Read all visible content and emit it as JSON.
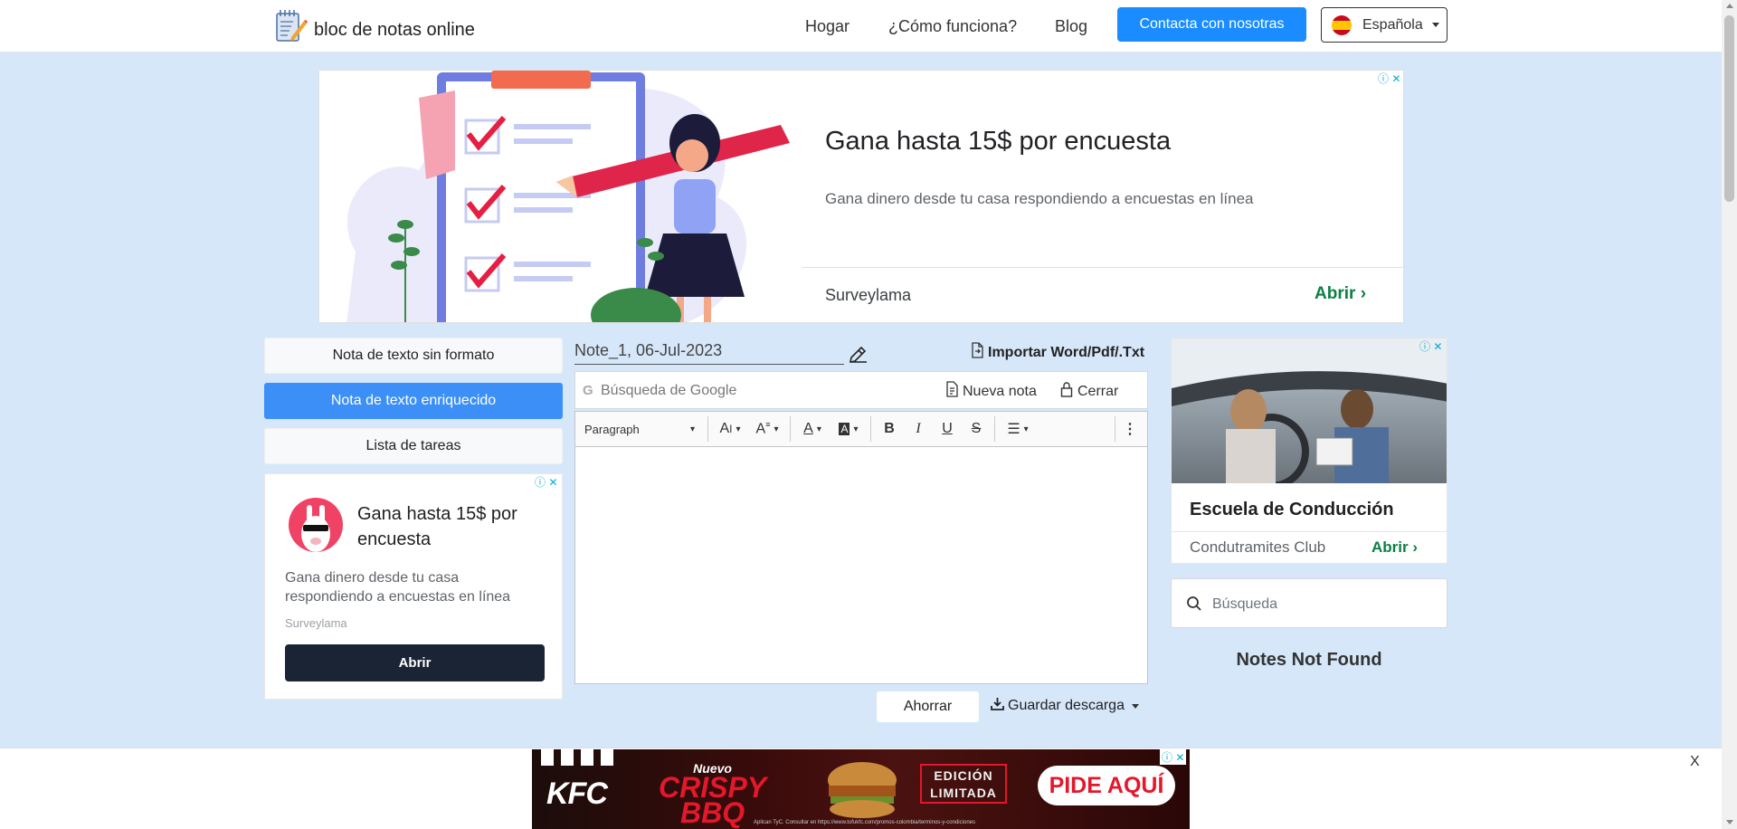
{
  "header": {
    "brand": "bloc de notas online",
    "nav": [
      "Hogar",
      "¿Cómo funciona?",
      "Blog"
    ],
    "contact_label": "Contacta con nosotras",
    "language": "Española"
  },
  "top_ad": {
    "title": "Gana hasta 15$ por encuesta",
    "description": "Gana dinero desde tu casa respondiendo a encuestas en línea",
    "advertiser": "Surveylama",
    "open_label": "Abrir"
  },
  "modes": {
    "plain": "Nota de texto sin formato",
    "rich": "Nota de texto enriquecido",
    "todo": "Lista de tareas"
  },
  "left_ad": {
    "title": "Gana hasta 15$ por encuesta",
    "description": "Gana dinero desde tu casa respondiendo a encuestas en línea",
    "advertiser": "Surveylama",
    "open_label": "Abrir"
  },
  "editor": {
    "note_name": "Note_1, 06-Jul-2023",
    "import_label": "Importar Word/Pdf/.Txt",
    "search_placeholder": "Búsqueda de Google",
    "new_note_label": "Nueva nota",
    "close_label": "Cerrar",
    "paragraph_style": "Paragraph",
    "save_later_label": "Ahorrar",
    "download_label": "Guardar descarga"
  },
  "right_ad": {
    "title": "Escuela de Conducción",
    "advertiser": "Condutramites Club",
    "open_label": "Abrir"
  },
  "sidebar": {
    "search_placeholder": "Búsqueda",
    "empty_message": "Notes Not Found"
  },
  "bottom_ad": {
    "brand": "KFC",
    "tag": "Nuevo",
    "product_line1": "CRISPY",
    "product_line2": "BBQ",
    "edition": "EDICIÓN LIMITADA",
    "cta": "PIDE AQUÍ",
    "legal": "Aplican TyC. Consultar en https://www.tofukfc.com/promos-colombia/terminos-y-condiciones",
    "close": "X"
  },
  "colors": {
    "page_bg": "#d6e7fa",
    "primary": "#1a8cff",
    "active_mode": "#3b8ff7",
    "ad_accent": "#0b8043"
  }
}
